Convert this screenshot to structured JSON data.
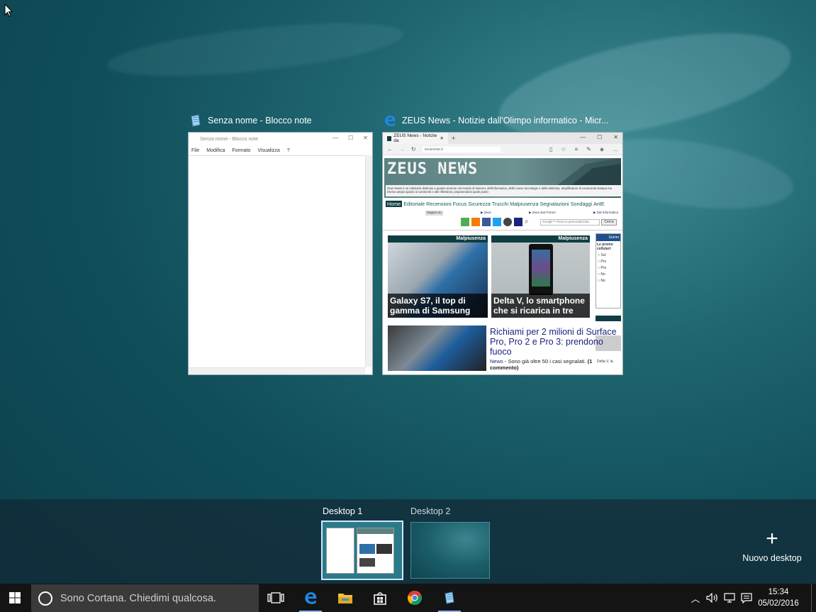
{
  "windows": [
    {
      "title": "Senza nome - Blocco note",
      "icon": "notepad-icon",
      "content": {
        "title_text": "Senza nome - Blocco note",
        "menu": [
          "File",
          "Modifica",
          "Formato",
          "Visualizza",
          "?"
        ]
      }
    },
    {
      "title": "ZEUS News - Notizie dall'Olimpo informatico - Micr...",
      "icon": "edge-icon",
      "content": {
        "tab_label": "ZEUS News - Notizie da",
        "address": "zeusnews.it",
        "logo": "ZEUS NEWS",
        "tagline": "Zeus News è un notiziario dedicato a quanto avviene nel mondo di Internet, dell'informatica, delle nuove tecnologie e della telefonia. amplificatore di comunicati stampa ma riserva ampio spazio ai commenti e alle riflessioni, proponendosi quale punto",
        "nav": [
          "Home",
          "Editoriale",
          "Recensioni",
          "Focus",
          "Sicurezza",
          "Trucchi",
          "Malpiusenza",
          "Segnalazioni",
          "Sondaggi",
          "AntE"
        ],
        "subnav": [
          "Seguici su",
          "▶ Zeus",
          "▶ Zeus and Forum",
          "▶ Dal Informatica"
        ],
        "search_placeholder": "Google™ Ricerca personalizzata",
        "search_button": "Cerca",
        "cards": [
          {
            "section": "Malpiusenza",
            "caption": "Galaxy S7, il top di gamma di Samsung"
          },
          {
            "section": "Malpiusenza",
            "caption": "Delta V, lo smartphone che si ricarica in tre"
          }
        ],
        "poll": {
          "header": "Summ",
          "question": "Le promo cellulari:",
          "options": [
            "Sol",
            "Pro",
            "Pro",
            "No",
            "No"
          ],
          "footer": "Delta V, la"
        },
        "article": {
          "title": "Richiami per 2 milioni di Surface Pro, Pro 2 e Pro 3: prendono fuoco",
          "category": "News",
          "summary": "- Sono già oltre 50 i casi segnalati.",
          "comments": "(1 commento)"
        }
      }
    }
  ],
  "desktops": [
    {
      "label": "Desktop 1",
      "active": true
    },
    {
      "label": "Desktop 2",
      "active": false
    }
  ],
  "new_desktop_label": "Nuovo desktop",
  "taskbar": {
    "search_placeholder": "Sono Cortana. Chiedimi qualcosa.",
    "apps": [
      "task-view-icon",
      "edge-icon",
      "file-explorer-icon",
      "store-icon",
      "chrome-icon",
      "notepad-icon"
    ],
    "tray": [
      "chevron-up-icon",
      "volume-icon",
      "network-icon",
      "action-center-icon"
    ],
    "time": "15:34",
    "date": "05/02/2016"
  },
  "colors": {
    "accent": "#8ab4f8",
    "zeus_dark": "#0e3e42",
    "taskbar_bg": "#141414",
    "desktop_bg": "#1f6670"
  }
}
